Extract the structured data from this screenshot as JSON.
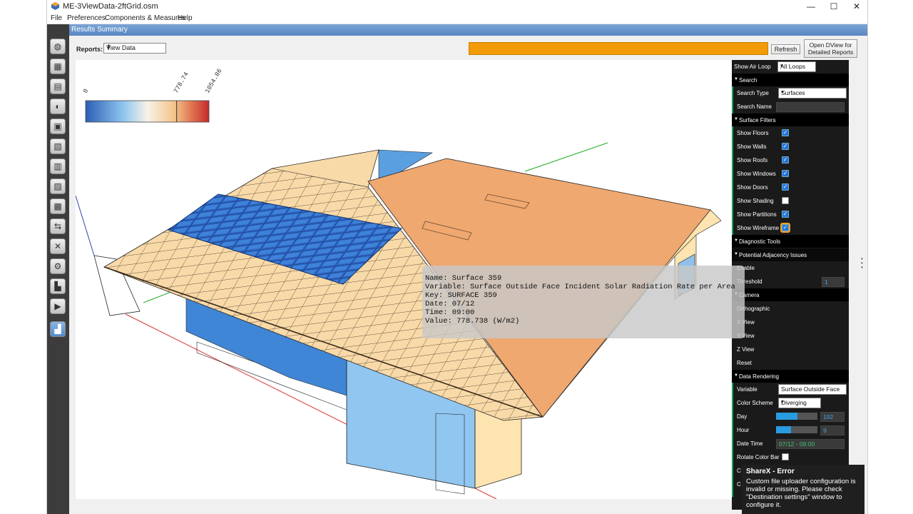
{
  "window": {
    "title": "ME-3ViewData-2ftGrid.osm",
    "controls": {
      "minimize": "—",
      "maximize": "☐",
      "close": "✕"
    }
  },
  "menu": [
    "File",
    "Preferences",
    "Components & Measures",
    "Help"
  ],
  "toolbar": {
    "icons": [
      "site-icon",
      "schedules-icon",
      "constructions-icon",
      "loads-icon",
      "space-types-icon",
      "geometry-icon",
      "facility-icon",
      "spaces-icon",
      "thermal-zones-icon",
      "hvac-icon",
      "output-variables-icon",
      "simulation-settings-icon",
      "measures-icon",
      "run-icon",
      "results-icon"
    ]
  },
  "results_bar": {
    "title": "Results Summary"
  },
  "controls": {
    "reports_label": "Reports:",
    "reports_value": "View Data",
    "refresh_label": "Refresh",
    "dview_label_1": "Open DView for",
    "dview_label_2": "Detailed Reports",
    "progress_color": "#f29b07"
  },
  "color_bar": {
    "min_label": "0",
    "mid_label": "778.74",
    "max_label": "1054.86",
    "scheme": "Diverging",
    "marker_fraction": 0.738
  },
  "tooltip": {
    "name": "Name: Surface 359",
    "variable": "Variable: Surface Outside Face Incident Solar Radiation Rate per Area",
    "key": "Key: SURFACE 359",
    "date": "Date: 07/12",
    "time": "Time: 09:00",
    "value": "Value: 778.738 (W/m2)"
  },
  "side_panel": {
    "air_loop_label": "Show Air Loop",
    "air_loop_value": "All Loops",
    "search_header": "Search",
    "search_type_label": "Search Type",
    "search_type_value": "Surfaces",
    "search_name_label": "Search Name",
    "surface_filters_header": "Surface Filters",
    "filters": [
      {
        "label": "Show Floors",
        "checked": true
      },
      {
        "label": "Show Walls",
        "checked": true
      },
      {
        "label": "Show Roofs",
        "checked": true
      },
      {
        "label": "Show Windows",
        "checked": true
      },
      {
        "label": "Show Doors",
        "checked": true
      },
      {
        "label": "Show Shading",
        "checked": false
      },
      {
        "label": "Show Partitions",
        "checked": true
      },
      {
        "label": "Show Wireframe",
        "checked": true
      }
    ],
    "diagnostic_header": "Diagnostic Tools",
    "adjacency_header": "Potential Adjacency Issues",
    "enable_label": "Enable",
    "threshold_label": "Threshold",
    "threshold_value": "1",
    "camera_header": "Camera",
    "orthographic_label": "Orthographic",
    "x_view_label": "X View",
    "y_view_label": "Y View",
    "z_view_label": "Z View",
    "reset_label": "Reset",
    "data_rendering_header": "Data Rendering",
    "variable_label": "Variable",
    "variable_value": "Surface Outside Face",
    "color_scheme_label": "Color Scheme",
    "color_scheme_value": "Diverging",
    "day_label": "Day",
    "day_value": "192",
    "day_fraction": 0.52,
    "hour_label": "Hour",
    "hour_value": "9",
    "hour_fraction": 0.37,
    "date_time_label": "Date Time",
    "date_time_value": "07/12 - 09:00",
    "rotate_label": "Rotate Color Bar",
    "cut1_label": "C",
    "cut2_label": "C"
  },
  "notification": {
    "title": "ShareX - Error",
    "message": "Custom file uploader configuration is invalid or missing. Please check \"Destination settings\" window to configure it."
  }
}
